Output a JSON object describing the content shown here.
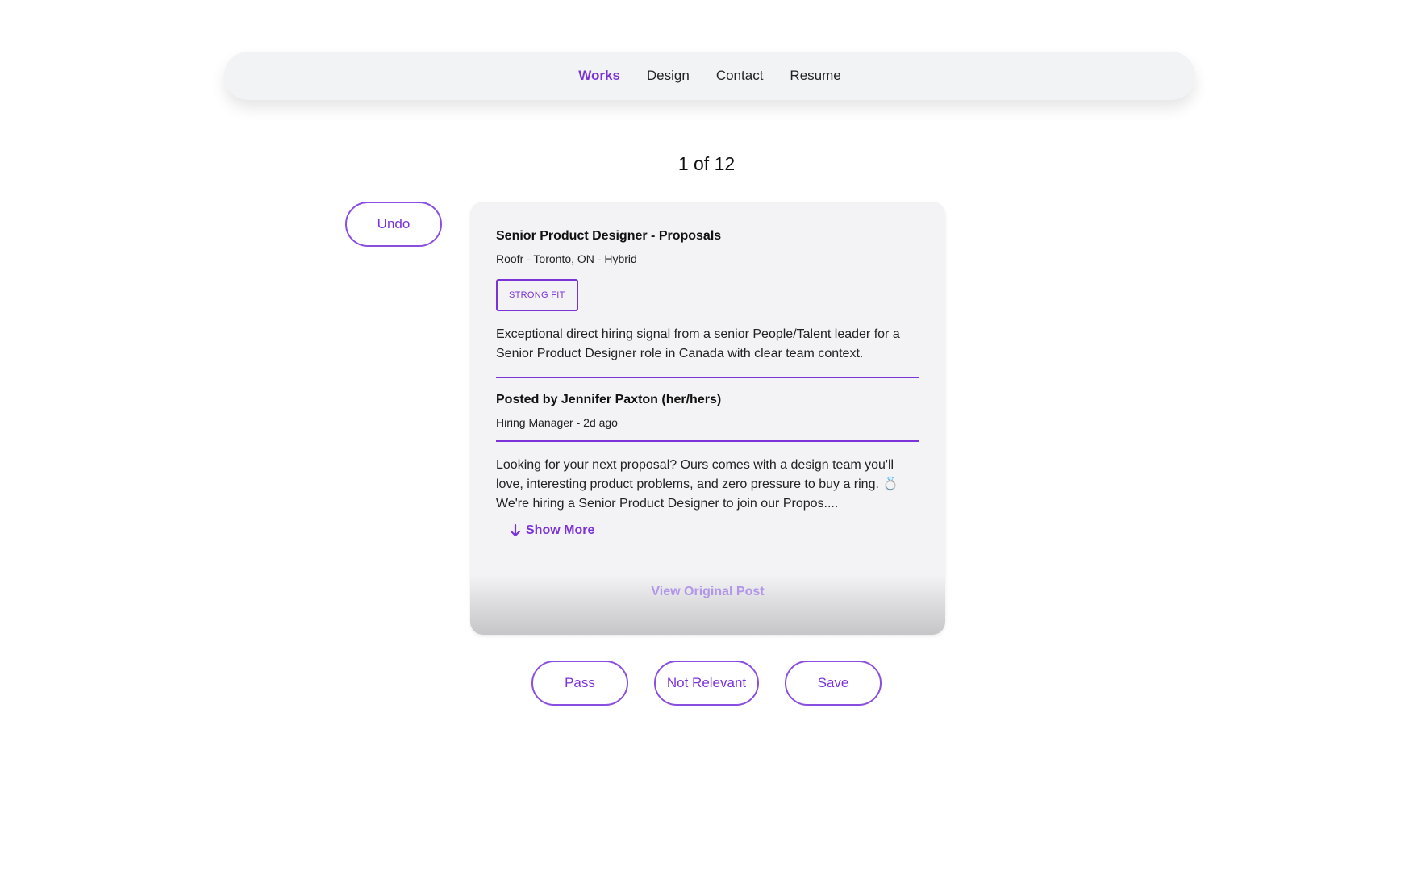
{
  "nav": {
    "items": [
      {
        "label": "Works",
        "active": true
      },
      {
        "label": "Design",
        "active": false
      },
      {
        "label": "Contact",
        "active": false
      },
      {
        "label": "Resume",
        "active": false
      }
    ]
  },
  "counter": "1 of 12",
  "undo_label": "Undo",
  "card": {
    "title": "Senior Product Designer - Proposals",
    "meta": "Roofr - Toronto, ON - Hybrid",
    "fit_badge": "STRONG FIT",
    "summary": "Exceptional direct hiring signal from a senior People/Talent leader for a Senior Product Designer role in Canada with clear team context.",
    "poster": "Posted by Jennifer Paxton (her/hers)",
    "poster_meta": "Hiring Manager - 2d ago",
    "post_body": "Looking for your next proposal? Ours comes with a design team you'll love, interesting product problems, and zero pressure to buy a ring. 💍 We're hiring a Senior Product Designer to join our Propos....",
    "show_more": "Show More",
    "view_original": "View Original Post"
  },
  "actions": {
    "pass": "Pass",
    "not_relevant": "Not Relevant",
    "save": "Save"
  },
  "colors": {
    "accent": "#7b33d9",
    "card_bg": "#f3f3f5",
    "nav_bg": "#f2f3f4"
  }
}
